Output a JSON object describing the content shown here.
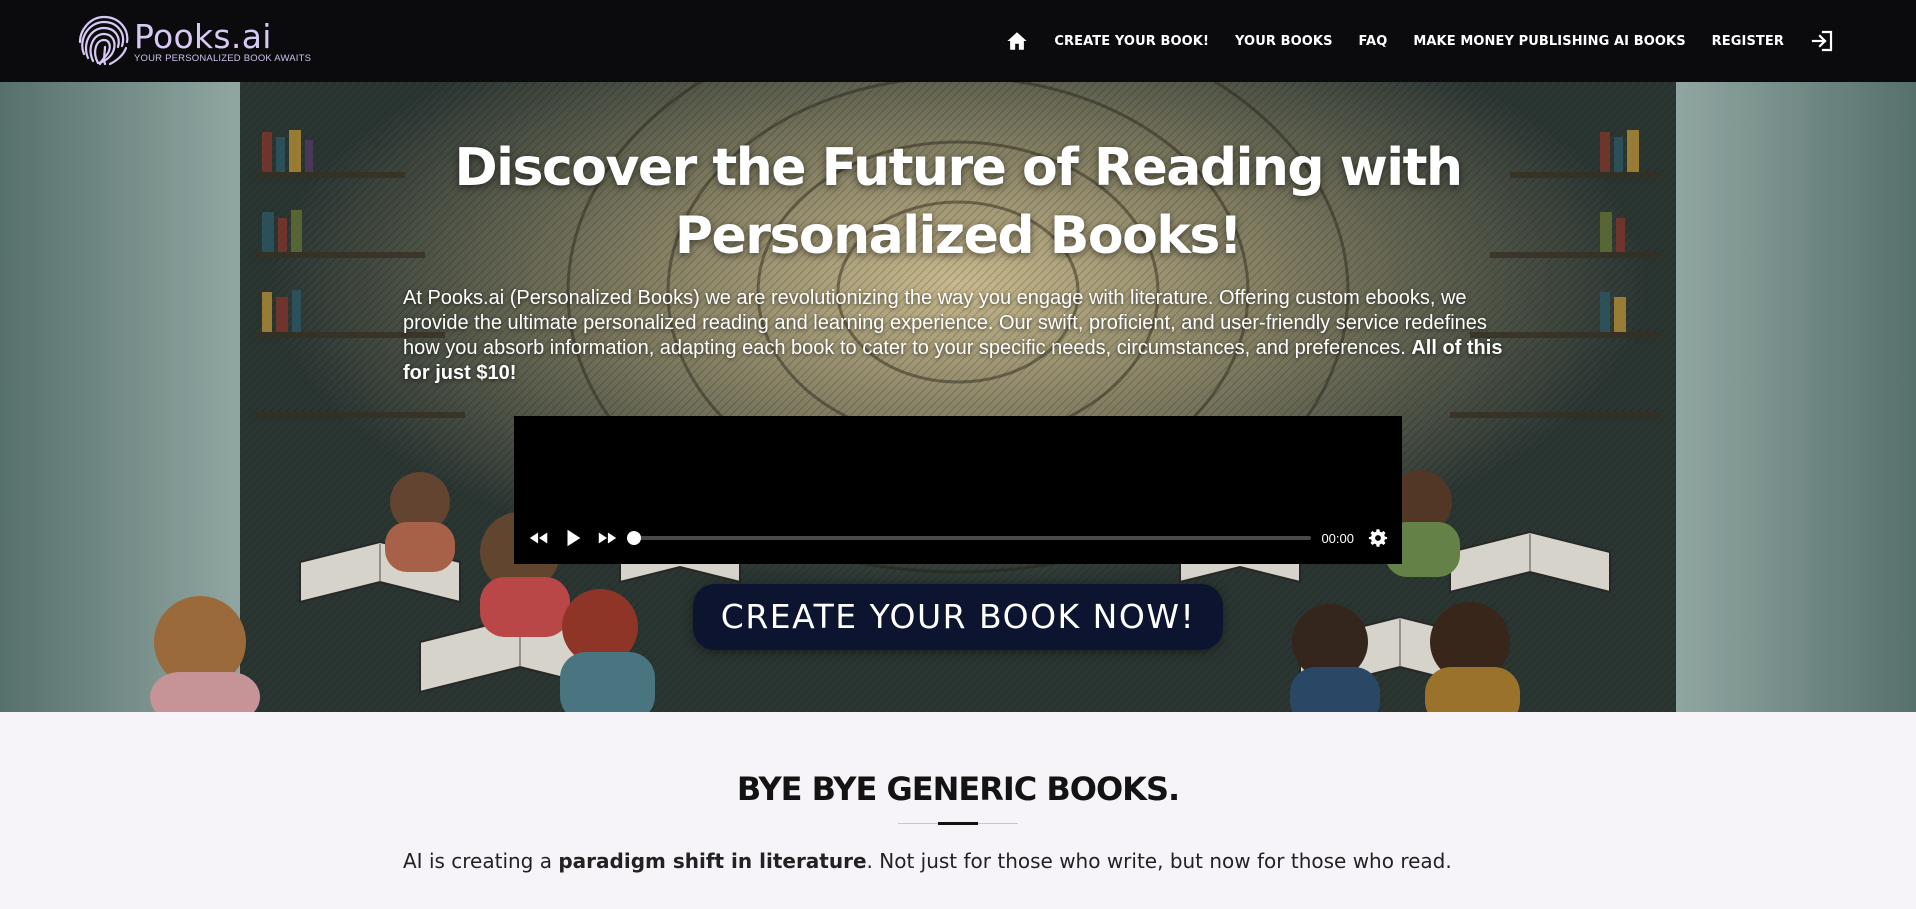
{
  "brand": {
    "name": "Pooks.ai",
    "tagline": "YOUR PERSONALIZED BOOK AWAITS"
  },
  "nav": {
    "home_icon": "home-icon",
    "items": [
      {
        "label": "CREATE YOUR BOOK!"
      },
      {
        "label": "YOUR BOOKS"
      },
      {
        "label": "FAQ"
      },
      {
        "label": "MAKE MONEY PUBLISHING AI BOOKS"
      },
      {
        "label": "REGISTER"
      }
    ],
    "login_icon": "sign-in-icon"
  },
  "hero": {
    "title_line1": "Discover the Future of Reading with",
    "title_line2": "Personalized Books!",
    "description": "At Pooks.ai (Personalized Books) we are revolutionizing the way you engage with literature. Offering custom ebooks, we provide the ultimate personalized reading and learning experience. Our swift, proficient, and user-friendly service redefines how you absorb information, adapting each book to cater to your specific needs, circumstances, and preferences. ",
    "description_bold": "All of this for just $10!",
    "cta_label": "CREATE YOUR BOOK NOW!"
  },
  "player": {
    "time": "00:00",
    "progress": 0,
    "controls": [
      "rewind-icon",
      "play-icon",
      "fast-forward-icon",
      "settings-icon"
    ]
  },
  "section": {
    "title": "BYE BYE GENERIC BOOKS.",
    "text_before": "AI is creating a ",
    "text_bold": "paradigm shift in literature",
    "text_after": ". Not just for those who write, but now for those who read."
  },
  "colors": {
    "header_bg": "#0b0b0d",
    "logo": "#d7c9f4",
    "cta_bg": "#0c1430",
    "page_bg": "#f6f4f9"
  }
}
